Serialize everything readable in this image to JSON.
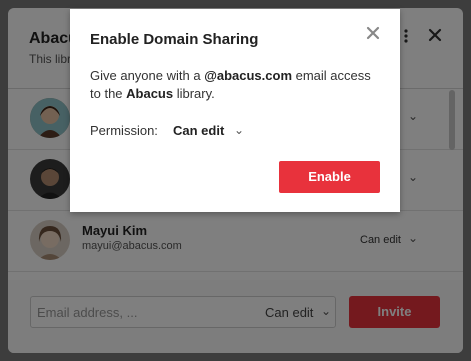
{
  "panel": {
    "title": "Abacus",
    "subtitle": "This library",
    "more_icon": "vertical-dots-icon",
    "close_icon": "close-icon"
  },
  "members": [
    {
      "name": "",
      "email": "",
      "permission": "",
      "avatar_color": "#9b7a5a"
    },
    {
      "name": "",
      "email": "",
      "permission": "",
      "avatar_color": "#4a4a4a"
    },
    {
      "name": "Mayui Kim",
      "email": "mayui@abacus.com",
      "permission": "Can edit",
      "avatar_color": "#c9b39a"
    }
  ],
  "invite": {
    "placeholder": "Email address, ...",
    "permission": "Can edit",
    "button_label": "Invite"
  },
  "modal": {
    "title": "Enable Domain Sharing",
    "close_icon": "close-icon",
    "body_prefix": "Give anyone with a ",
    "body_domain": "@abacus.com",
    "body_middle": " email access to the ",
    "body_library": "Abacus",
    "body_suffix": " library.",
    "permission_label": "Permission:",
    "permission_value": "Can edit",
    "enable_label": "Enable"
  },
  "colors": {
    "accent": "#e8323c",
    "overlay": "rgba(0,0,0,0.5)"
  }
}
